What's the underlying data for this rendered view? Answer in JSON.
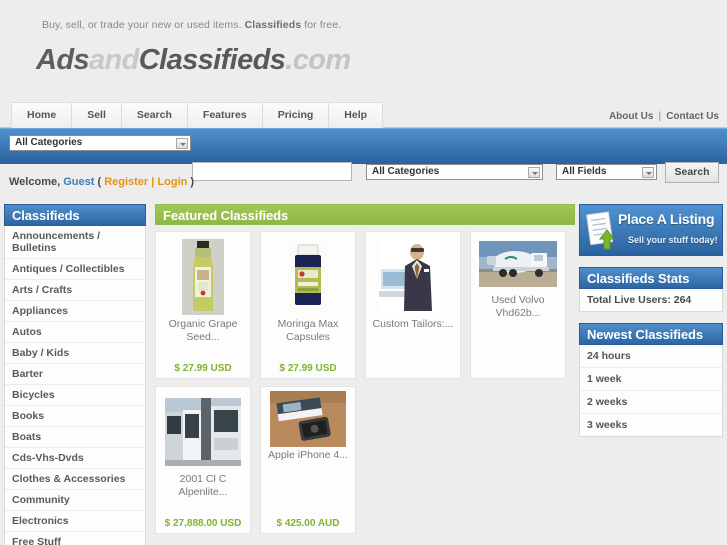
{
  "header": {
    "tagline_pre": "Buy, sell, or trade your new or used items. ",
    "tagline_bold": "Classifieds",
    "tagline_post": " for free.",
    "logo_part1": "Ads",
    "logo_part2": "and",
    "logo_part3": "Classifieds",
    "logo_part4": ".com"
  },
  "nav": {
    "items": [
      {
        "label": "Home"
      },
      {
        "label": "Sell"
      },
      {
        "label": "Search"
      },
      {
        "label": "Features"
      },
      {
        "label": "Pricing"
      },
      {
        "label": "Help"
      }
    ],
    "about_us": "About Us",
    "separator": "|",
    "contact_us": "Contact Us"
  },
  "searchbar": {
    "category_select": "All Categories",
    "query_value": "",
    "query_placeholder": "",
    "field_category_select": "All Categories",
    "field_scope_select": "All Fields",
    "search_button": "Search"
  },
  "welcome": {
    "prefix": "Welcome, ",
    "user": "Guest",
    "open_paren": " ( ",
    "register": "Register",
    "pipe": " | ",
    "login": "Login",
    "close_paren": " )"
  },
  "sidebar": {
    "title": "Classifieds",
    "items": [
      {
        "label": "Announcements / Bulletins"
      },
      {
        "label": "Antiques / Collectibles"
      },
      {
        "label": "Arts / Crafts"
      },
      {
        "label": "Appliances"
      },
      {
        "label": "Autos"
      },
      {
        "label": "Baby / Kids"
      },
      {
        "label": "Barter"
      },
      {
        "label": "Bicycles"
      },
      {
        "label": "Books"
      },
      {
        "label": "Boats"
      },
      {
        "label": "Cds-Vhs-Dvds"
      },
      {
        "label": "Clothes & Accessories"
      },
      {
        "label": "Community"
      },
      {
        "label": "Electronics"
      },
      {
        "label": "Free Stuff"
      }
    ]
  },
  "featured": {
    "title": "Featured Classifieds",
    "cards": [
      {
        "title": "Organic Grape Seed...",
        "price": "$ 27.99 USD",
        "image": "organic-grape-seed-oil-bottle"
      },
      {
        "title": "Moringa Max Capsules",
        "price": "$ 27.99 USD",
        "image": "moringa-max-capsules-jar"
      },
      {
        "title": "Custom Tailors:...",
        "price": "",
        "image": "man-in-suit"
      },
      {
        "title": "Used Volvo Vhd62b...",
        "price": "",
        "image": "cement-mixer-truck"
      },
      {
        "title": "2001 Cl C Alpenlite...",
        "price": "$ 27,888.00 USD",
        "image": "rv-trailer-door"
      },
      {
        "title": "Apple iPhone 4...",
        "price": "$ 425.00 AUD",
        "image": "iphone-box-and-phone"
      }
    ]
  },
  "promo": {
    "title": "Place A Listing",
    "subtitle": "Sell your stuff today!",
    "icon": "document-upload-icon"
  },
  "stats": {
    "title": "Classifieds Stats",
    "live_users_label": "Total Live Users: 264"
  },
  "newest": {
    "title": "Newest Classifieds",
    "items": [
      {
        "label": "24 hours"
      },
      {
        "label": "1 week"
      },
      {
        "label": "2 weeks"
      },
      {
        "label": "3 weeks"
      }
    ]
  },
  "colors": {
    "blue": "#2d65a2",
    "green": "#8eb844",
    "price_green": "#82b32b",
    "link_orange": "#e8930f",
    "guest_blue": "#3a7bbf"
  }
}
